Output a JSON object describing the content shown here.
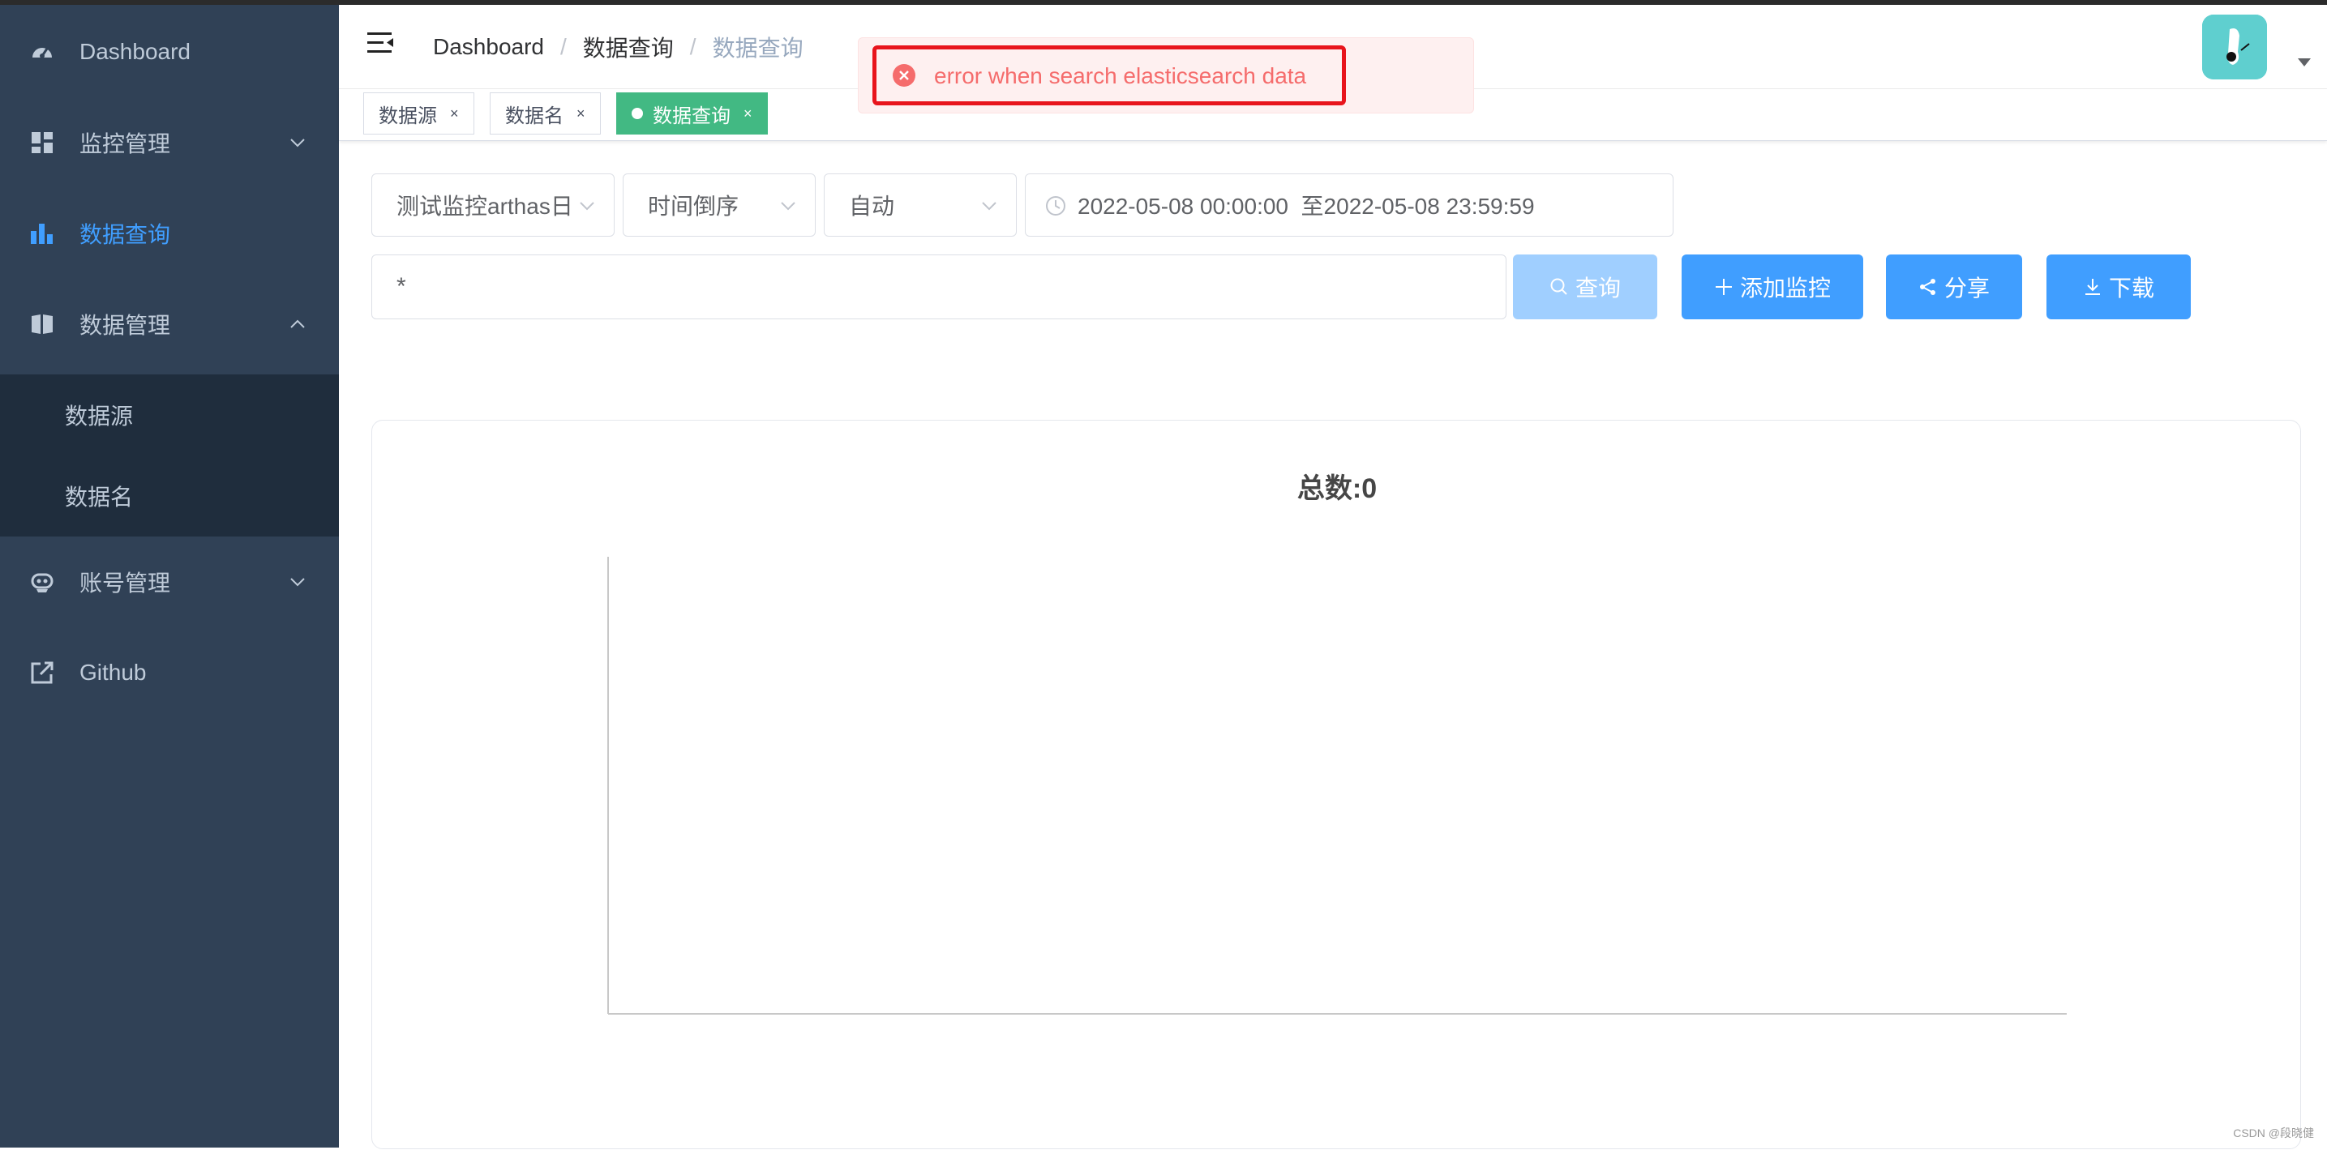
{
  "sidebar": {
    "items": [
      {
        "label": "Dashboard",
        "icon": "dashboard-icon"
      },
      {
        "label": "监控管理",
        "icon": "grid-icon"
      },
      {
        "label": "数据查询",
        "icon": "bar-chart-icon"
      },
      {
        "label": "数据管理",
        "icon": "book-icon"
      },
      {
        "label": "账号管理",
        "icon": "robot-icon"
      },
      {
        "label": "Github",
        "icon": "external-link-icon"
      }
    ],
    "submenu": [
      {
        "label": "数据源"
      },
      {
        "label": "数据名"
      }
    ],
    "active_color": "#409eff"
  },
  "navbar": {
    "breadcrumb": [
      "Dashboard",
      "数据查询",
      "数据查询"
    ],
    "separator": "/"
  },
  "tags": [
    {
      "label": "数据源",
      "close": "×"
    },
    {
      "label": "数据名",
      "close": "×"
    },
    {
      "label": "数据查询",
      "close": "×",
      "active": true
    }
  ],
  "filters": {
    "monitor_select": "测试监控arthas日",
    "order_select": "时间倒序",
    "interval_select": "自动",
    "date_range": "2022-05-08 00:00:00  至2022-05-08 23:59:59"
  },
  "query": {
    "value": "*"
  },
  "buttons": {
    "search": "查询",
    "add_monitor": "添加监控",
    "share": "分享",
    "download": "下载"
  },
  "chart": {
    "title": "总数:0"
  },
  "chart_data": {
    "type": "bar",
    "title": "总数:0",
    "categories": [],
    "values": [],
    "xlabel": "",
    "ylabel": ""
  },
  "message": {
    "text": "error when search elasticsearch data",
    "type": "error",
    "color": "#f56c6c"
  },
  "watermark": "CSDN @段晓健"
}
